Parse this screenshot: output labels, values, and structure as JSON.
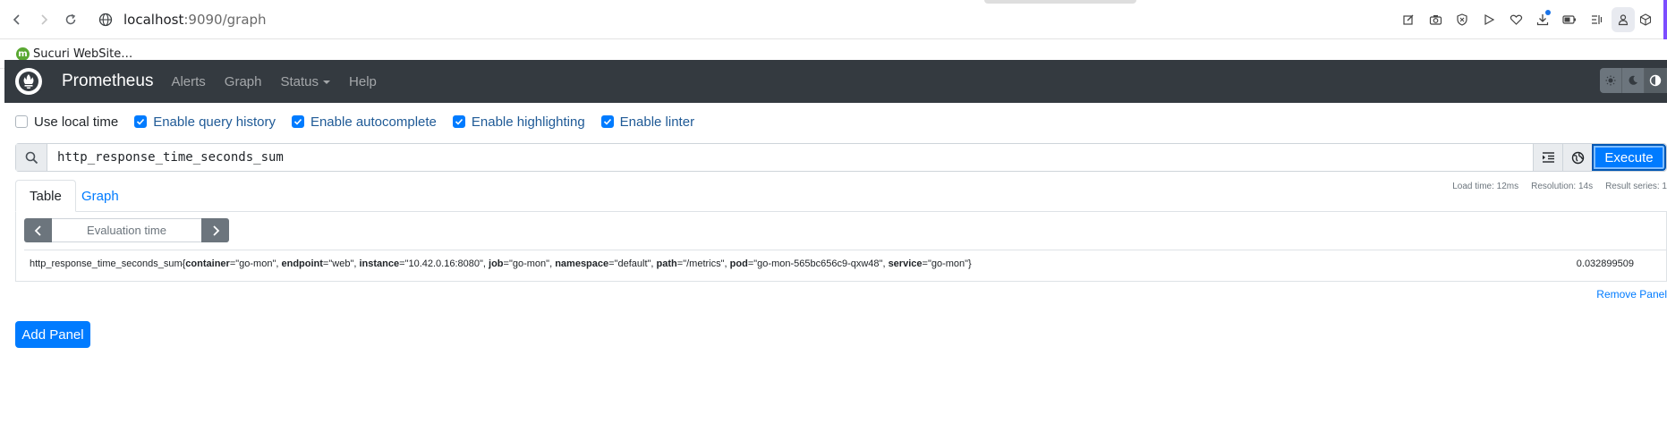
{
  "browser": {
    "url_host": "localhost",
    "url_rest": ":9090/graph",
    "bookmark_label": "Sucuri WebSite…",
    "bookmark_icon_letter": "m"
  },
  "navbar": {
    "brand": "Prometheus",
    "links": [
      "Alerts",
      "Graph",
      "Status",
      "Help"
    ]
  },
  "options": [
    {
      "label": "Use local time",
      "checked": false
    },
    {
      "label": "Enable query history",
      "checked": true
    },
    {
      "label": "Enable autocomplete",
      "checked": true
    },
    {
      "label": "Enable highlighting",
      "checked": true
    },
    {
      "label": "Enable linter",
      "checked": true
    }
  ],
  "query": {
    "value": "http_response_time_seconds_sum",
    "execute_label": "Execute"
  },
  "tabs": {
    "table": "Table",
    "graph": "Graph"
  },
  "stats": {
    "load_time": "Load time: 12ms",
    "resolution": "Resolution: 14s",
    "result_series": "Result series: 1"
  },
  "panel": {
    "eval_placeholder": "Evaluation time",
    "series": {
      "metric": "http_response_time_seconds_sum",
      "labels": [
        {
          "key": "container",
          "value": "\"go-mon\""
        },
        {
          "key": "endpoint",
          "value": "\"web\""
        },
        {
          "key": "instance",
          "value": "\"10.42.0.16:8080\""
        },
        {
          "key": "job",
          "value": "\"go-mon\""
        },
        {
          "key": "namespace",
          "value": "\"default\""
        },
        {
          "key": "path",
          "value": "\"/metrics\""
        },
        {
          "key": "pod",
          "value": "\"go-mon-565bc656c9-qxw48\""
        },
        {
          "key": "service",
          "value": "\"go-mon\""
        }
      ],
      "value": "0.032899509"
    },
    "remove_label": "Remove Panel"
  },
  "add_panel_label": "Add Panel",
  "colors": {
    "navbar_bg": "#343a40",
    "primary": "#007bff"
  }
}
